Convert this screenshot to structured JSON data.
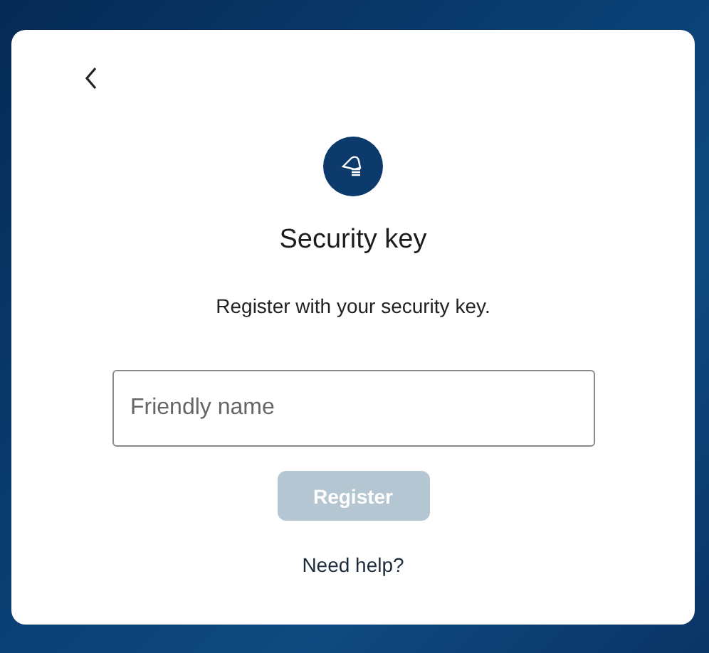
{
  "title": "Security key",
  "subtitle": "Register with your security key.",
  "name_field": {
    "placeholder": "Friendly name"
  },
  "register_button": {
    "label": "Register",
    "disabled": true
  },
  "help_link": "Need help?"
}
